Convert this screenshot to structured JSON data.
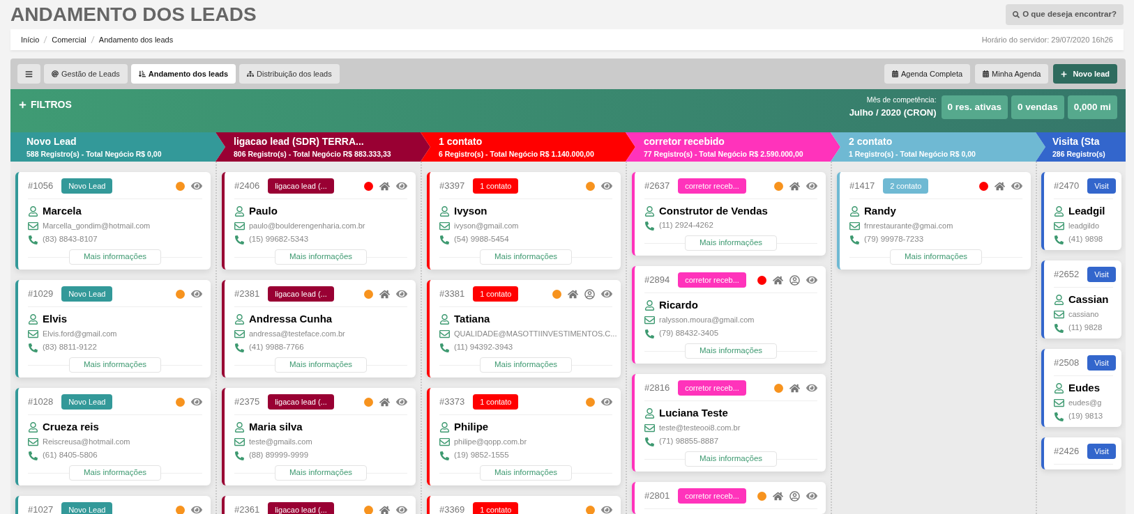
{
  "page_title": "ANDAMENTO DOS LEADS",
  "search_button": "O que deseja encontrar?",
  "breadcrumb": [
    "Início",
    "Comercial",
    "Andamento dos leads"
  ],
  "server_time": "Horário do servidor: 29/07/2020 16h26",
  "toolbar": {
    "tabs": [
      {
        "label": "Gestão de Leads",
        "selected": false
      },
      {
        "label": "Andamento dos leads",
        "selected": true
      },
      {
        "label": "Distribuição dos leads",
        "selected": false
      }
    ],
    "actions": [
      {
        "label": "Agenda Completa",
        "kind": "default"
      },
      {
        "label": "Minha Agenda",
        "kind": "default"
      },
      {
        "label": "Novo lead",
        "kind": "primary"
      }
    ]
  },
  "filters": {
    "label": "FILTROS",
    "period_label": "Mês de competência:",
    "period": "Julho / 2020 (CRON)",
    "stats": [
      "0 res. ativas",
      "0 vendas",
      "0,000 mi"
    ]
  },
  "columns": [
    {
      "title": "Novo Lead",
      "summary": "588 Registro(s) - Total Negócio R$ 0,00",
      "color": "#339999",
      "cards": [
        {
          "id": "#1056",
          "badge": "Novo Lead",
          "color": "#f7931e",
          "has_property": false,
          "has_broker": false,
          "viewable": true,
          "name": "Marcela",
          "email": "Marcella_gondim@hotmail.com",
          "phone": "(83) 8843-8107",
          "more": "Mais informações"
        },
        {
          "id": "#1029",
          "badge": "Novo Lead",
          "color": "#f7931e",
          "has_property": false,
          "has_broker": false,
          "viewable": true,
          "name": "Elvis",
          "email": "Elvis.ford@gmail.com",
          "phone": "(83) 8811-9122",
          "more": "Mais informações"
        },
        {
          "id": "#1028",
          "badge": "Novo Lead",
          "color": "#f7931e",
          "has_property": false,
          "has_broker": false,
          "viewable": true,
          "name": "Crueza reis",
          "email": "Reiscreusa@hotmail.com",
          "phone": "(61) 8405-5806",
          "more": "Mais informações"
        },
        {
          "id": "#1027",
          "badge": "Novo Lead",
          "color": "#f7931e",
          "has_property": false,
          "has_broker": false,
          "viewable": true
        }
      ]
    },
    {
      "title": "ligacao lead (SDR) TERRA...",
      "summary": "806 Registro(s) - Total Negócio R$ 883.333,33",
      "color": "#990033",
      "cards": [
        {
          "id": "#2406",
          "badge": "ligacao lead (...",
          "color": "#ff0000",
          "has_property": true,
          "has_broker": false,
          "viewable": true,
          "name": "Paulo",
          "email": "paulo@boulderengenharia.com.br",
          "phone": "(15) 99682-5343",
          "more": "Mais informações"
        },
        {
          "id": "#2381",
          "badge": "ligacao lead (...",
          "color": "#f7931e",
          "has_property": true,
          "has_broker": false,
          "viewable": true,
          "name": "Andressa Cunha",
          "email": "andressa@testeface.com.br",
          "phone": "(41) 9988-7766",
          "more": "Mais informações"
        },
        {
          "id": "#2375",
          "badge": "ligacao lead (...",
          "color": "#f7931e",
          "has_property": true,
          "has_broker": false,
          "viewable": true,
          "name": "Maria silva",
          "email": "teste@gmails.com",
          "phone": "(88) 89999-9999",
          "more": "Mais informações"
        },
        {
          "id": "#2361",
          "badge": "ligacao lead (...",
          "color": "#f7931e",
          "has_property": true,
          "has_broker": false,
          "viewable": true
        }
      ]
    },
    {
      "title": "1 contato",
      "summary": "6 Registro(s) - Total Negócio R$ 1.140.000,00",
      "color": "#ff0000",
      "cards": [
        {
          "id": "#3397",
          "badge": "1 contato",
          "color": "#f7931e",
          "has_property": false,
          "has_broker": false,
          "viewable": true,
          "name": "Ivyson",
          "email": "ivyson@gmail.com",
          "phone": "(54) 9988-5454",
          "more": "Mais informações"
        },
        {
          "id": "#3381",
          "badge": "1 contato",
          "color": "#f7931e",
          "has_property": true,
          "has_broker": true,
          "viewable": true,
          "name": "Tatiana",
          "email": "QUALIDADE@MASOTTIINVESTIMENTOS.C...",
          "phone": "(11) 94392-3943",
          "more": "Mais informações"
        },
        {
          "id": "#3373",
          "badge": "1 contato",
          "color": "#f7931e",
          "has_property": false,
          "has_broker": false,
          "viewable": true,
          "name": "Philipe",
          "email": "philipe@qopp.com.br",
          "phone": "(19) 9852-1555",
          "more": "Mais informações"
        },
        {
          "id": "#3369",
          "badge": "1 contato",
          "color": "#f7931e",
          "has_property": false,
          "has_broker": false,
          "viewable": true
        }
      ]
    },
    {
      "title": "corretor recebido",
      "summary": "77 Registro(s) - Total Negócio R$ 2.590.000,00",
      "color": "#ff33bb",
      "cards": [
        {
          "id": "#2637",
          "badge": "corretor receb...",
          "color": "#f7931e",
          "has_property": true,
          "has_broker": false,
          "viewable": true,
          "name": "Construtor de Vendas",
          "phone": "(11) 2924-4262",
          "more": "Mais informações"
        },
        {
          "id": "#2894",
          "badge": "corretor receb...",
          "color": "#ff0000",
          "has_property": true,
          "has_broker": true,
          "viewable": true,
          "name": "Ricardo",
          "email": "ralysson.moura@gmail.com",
          "phone": "(79) 88432-3405",
          "more": "Mais informações"
        },
        {
          "id": "#2816",
          "badge": "corretor receb...",
          "color": "#f7931e",
          "has_property": true,
          "has_broker": false,
          "viewable": true,
          "name": "Luciana Teste",
          "email": "teste@testeooi8.com.br",
          "phone": "(71) 98855-8887",
          "more": "Mais informações"
        },
        {
          "id": "#2801",
          "badge": "corretor receb...",
          "color": "#f7931e",
          "has_property": true,
          "has_broker": true,
          "viewable": true
        }
      ]
    },
    {
      "title": "2 contato",
      "summary": "1 Registro(s) - Total Negócio R$ 0,00",
      "color": "#6fb9d3",
      "cards": [
        {
          "id": "#1417",
          "badge": "2 contato",
          "color": "#ff0000",
          "has_property": true,
          "has_broker": false,
          "viewable": true,
          "name": "Randy",
          "email": "frnrestaurante@gmai.com",
          "phone": "(79) 99978-7233",
          "more": "Mais informações"
        }
      ]
    },
    {
      "title": "Visita (Sta",
      "summary": "286 Registro(s)",
      "color": "#3366cc",
      "cards": [
        {
          "id": "#2470",
          "badge": "Visit",
          "name": "Leadgil",
          "email": "leadgildo",
          "phone": "(41) 9898"
        },
        {
          "id": "#2652",
          "badge": "Visit",
          "name": "Cassian",
          "email": "cassiano",
          "phone": "(11) 9828"
        },
        {
          "id": "#2508",
          "badge": "Visit",
          "name": "Eudes",
          "email": "eudes@g",
          "phone": "(19) 9813"
        },
        {
          "id": "#2426",
          "badge": "Visit"
        }
      ]
    }
  ]
}
